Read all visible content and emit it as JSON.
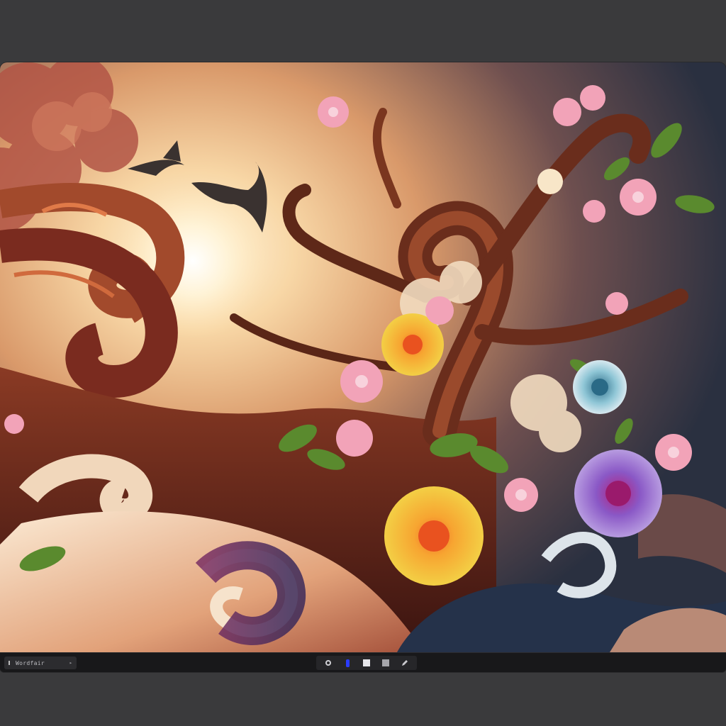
{
  "window": {
    "background_color": "#3a3a3c",
    "frame_color": "#1b1b1d"
  },
  "canvas": {
    "image_subject": "painted-artwork",
    "palette": [
      "#f6d9b0",
      "#e98f4a",
      "#7a2b1f",
      "#5b3a7a",
      "#2c3a4f",
      "#f5b5c8",
      "#f3c84a"
    ]
  },
  "status_bar": {
    "file_chip": {
      "label": "Wordfair",
      "arrow": "▸"
    },
    "toolbar": {
      "tools": [
        {
          "name": "record-tool",
          "icon": "circle-icon"
        },
        {
          "name": "pen-tool",
          "icon": "pen-icon",
          "color": "#2a3cff"
        },
        {
          "name": "light-square-tool",
          "icon": "square-icon"
        },
        {
          "name": "gray-square-tool",
          "icon": "square-icon"
        },
        {
          "name": "pencil-tool",
          "icon": "pencil-icon"
        }
      ]
    }
  }
}
